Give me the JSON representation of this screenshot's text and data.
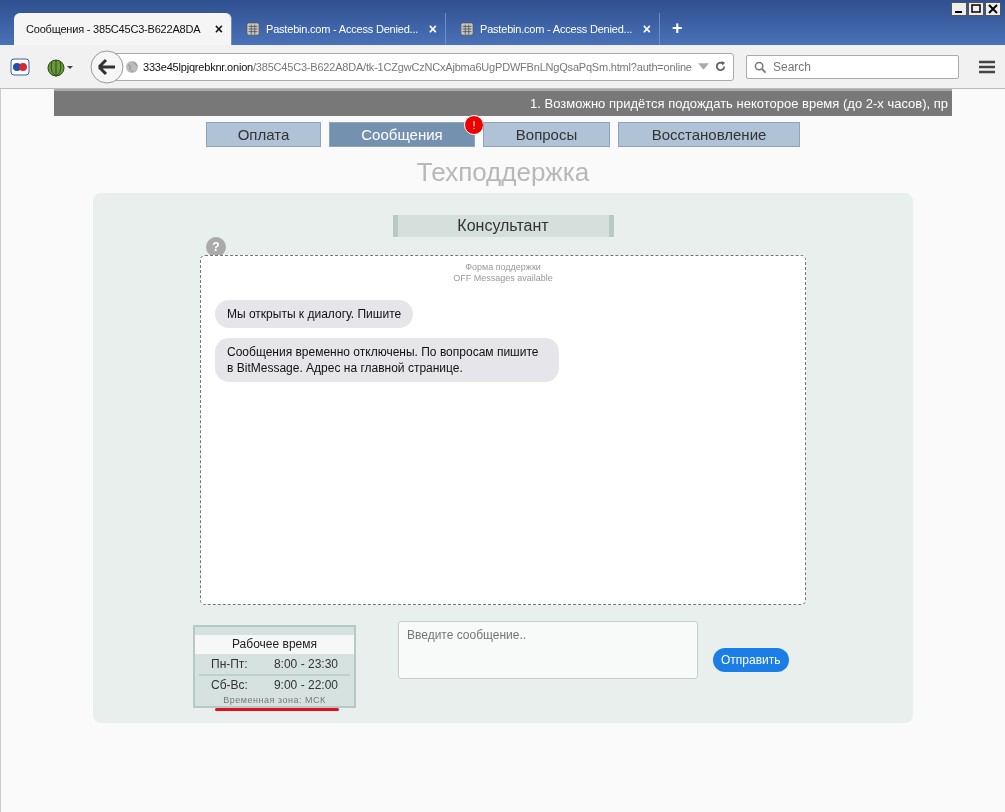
{
  "browser": {
    "tabs": [
      {
        "title": "Сообщения - 385C45C3-B622A8DA",
        "selected": true,
        "kind": "page",
        "close": "×"
      },
      {
        "title": "Pastebin.com - Access Denied...",
        "selected": false,
        "kind": "pastebin",
        "close": "×"
      },
      {
        "title": "Pastebin.com - Access Denied...",
        "selected": false,
        "kind": "pastebin",
        "close": "×"
      }
    ],
    "new_tab": "+",
    "address": {
      "host": "333e45lpjqrebknr.onion",
      "path": "/385C45C3-B622A8DA/tk-1CZgwCzNCxAjbma6UgPDWFBnLNgQsaPqSm.html?auth=online"
    },
    "search": {
      "placeholder": "Search"
    }
  },
  "page": {
    "notice": "1. Возможно придётся подождать некоторое время (до 2-х часов), пр",
    "nav": [
      {
        "label": "Оплата",
        "selected": false
      },
      {
        "label": "Сообщения",
        "selected": true,
        "badge": "!"
      },
      {
        "label": "Вопросы",
        "selected": false
      },
      {
        "label": "Восстановление",
        "selected": false
      }
    ],
    "heading": "Техподдержка",
    "consultant": "Консультант",
    "help": "?",
    "form_title": "Форма поддержки",
    "form_status": "OFF Messages available",
    "messages": [
      "Мы открыты к диалогу. Пишите",
      "Сообщения временно отключены. По вопросам пишите в BitMessage. Адрес на главной странице."
    ],
    "hours": {
      "title": "Рабочее время",
      "rows": [
        {
          "days": "Пн-Пт:",
          "time": "8:00 - 23:30"
        },
        {
          "days": "Сб-Вс:",
          "time": "9:00 - 22:00"
        }
      ],
      "timezone": "Временная зона: МСК"
    },
    "message_input": {
      "placeholder": "Введите сообщение.."
    },
    "send": "Отправить"
  }
}
